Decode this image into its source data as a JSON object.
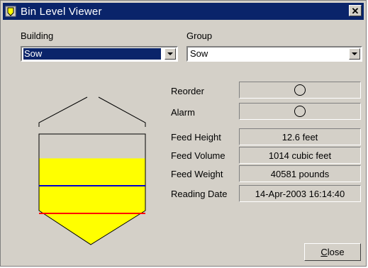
{
  "window": {
    "title": "Bin Level Viewer",
    "close_glyph": "✕"
  },
  "building": {
    "label": "Building",
    "value": "Sow"
  },
  "group": {
    "label": "Group",
    "value": "Sow"
  },
  "indicators": [
    {
      "label": "Reorder"
    },
    {
      "label": "Alarm"
    }
  ],
  "readings": [
    {
      "label": "Feed Height",
      "value": "12.6 feet"
    },
    {
      "label": "Feed Volume",
      "value": "1014 cubic feet"
    },
    {
      "label": "Feed Weight",
      "value": "40581 pounds"
    },
    {
      "label": "Reading Date",
      "value": "14-Apr-2003 16:14:40"
    }
  ],
  "bin": {
    "fill_color": "#ffff00",
    "reorder_line_color": "#0000cc",
    "alarm_line_color": "#ff0000",
    "fill_fraction": 0.78
  },
  "close_button": {
    "accel": "C",
    "rest": "lose"
  },
  "colors": {
    "titlebar": "#0a246a",
    "face": "#d4d0c8"
  },
  "icons": {
    "app": "bin-app-icon",
    "dropdown": "chevron-down-icon"
  }
}
